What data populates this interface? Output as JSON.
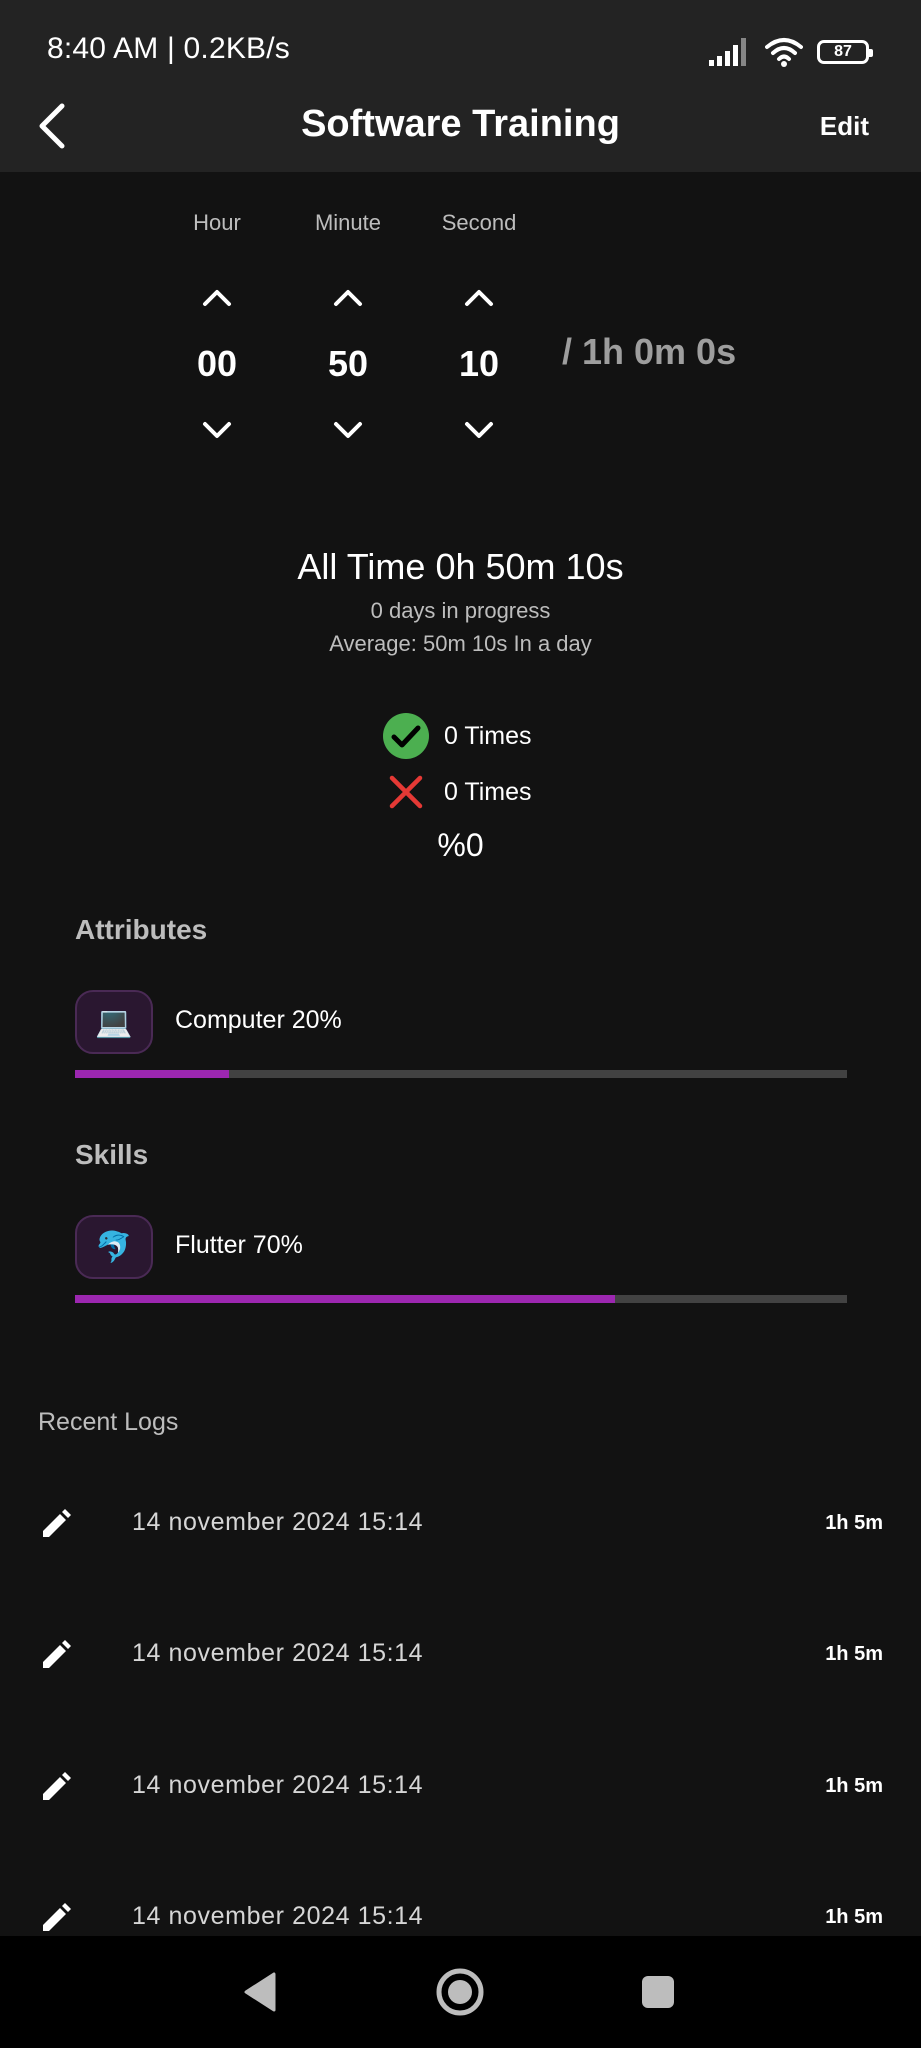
{
  "status_bar": {
    "time_speed": "8:40 AM | 0.2KB/s",
    "battery": "87"
  },
  "app_bar": {
    "title": "Software Training",
    "edit_label": "Edit"
  },
  "timer": {
    "hour_label": "Hour",
    "minute_label": "Minute",
    "second_label": "Second",
    "hour_value": "00",
    "minute_value": "50",
    "second_value": "10",
    "target": "/ 1h 0m 0s"
  },
  "summary": {
    "all_time": "All Time 0h 50m 10s",
    "days_in_progress": "0 days in progress",
    "average": "Average: 50m 10s In a day",
    "success_count": "0 Times",
    "fail_count": "0 Times",
    "percent": "%0"
  },
  "attributes": {
    "title": "Attributes",
    "items": [
      {
        "icon": "💻",
        "label": "Computer 20%",
        "progress": 0.2
      }
    ]
  },
  "skills": {
    "title": "Skills",
    "items": [
      {
        "icon": "🐬",
        "label": "Flutter 70%",
        "progress": 0.7
      }
    ]
  },
  "logs": {
    "title": "Recent Logs",
    "items": [
      {
        "date": "14 november 2024 15:14",
        "duration": "1h 5m"
      },
      {
        "date": "14 november 2024 15:14",
        "duration": "1h 5m"
      },
      {
        "date": "14 november 2024 15:14",
        "duration": "1h 5m"
      },
      {
        "date": "14 november 2024 15:14",
        "duration": "1h 5m"
      }
    ]
  },
  "colors": {
    "accent": "#9c27b0",
    "success": "#4caf50",
    "fail": "#e53935",
    "background": "#121212",
    "appbar": "#232323"
  }
}
